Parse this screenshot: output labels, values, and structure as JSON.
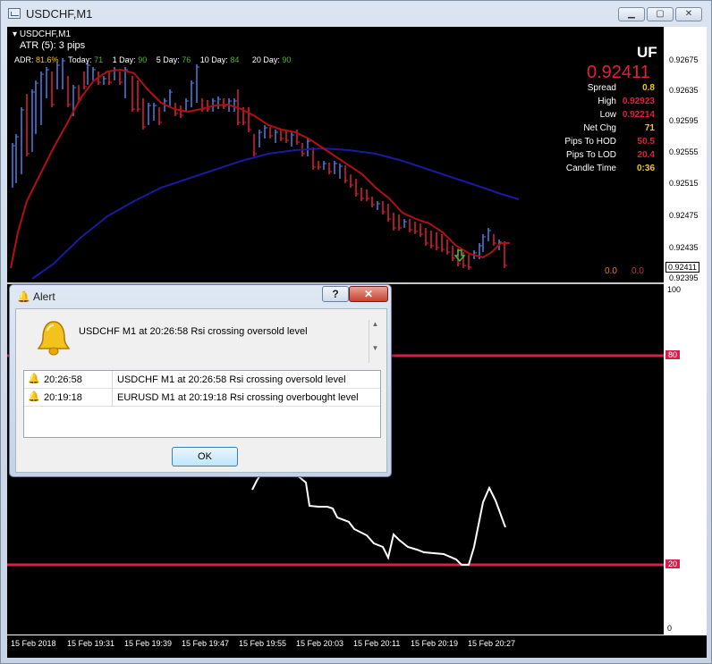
{
  "window": {
    "title": "USDCHF,M1",
    "min_glyph": "▁",
    "max_glyph": "▢",
    "close_glyph": "✕"
  },
  "chart": {
    "symbol_label": "USDCHF,M1",
    "atr_label": "ATR (5): 3 pips",
    "adr": {
      "label": "ADR:",
      "value": "81.6%"
    },
    "today": {
      "label": "Today:",
      "value": "71"
    },
    "day1": {
      "label": "1 Day:",
      "value": "90"
    },
    "day5": {
      "label": "5 Day:",
      "value": "76"
    },
    "day10": {
      "label": "10 Day:",
      "value": "84"
    },
    "day20": {
      "label": "20 Day:",
      "value": "90"
    },
    "symbol_short": "UF",
    "current_price": "0.92411",
    "info": [
      {
        "label": "Spread",
        "value": "0.8",
        "color": "#f5c518"
      },
      {
        "label": "High",
        "value": "0.92923",
        "color": "#e0203a"
      },
      {
        "label": "Low",
        "value": "0.92214",
        "color": "#e0203a"
      },
      {
        "label": "Net Chg",
        "value": "71",
        "color": "#f5c518"
      },
      {
        "label": "Pips To HOD",
        "value": "50.5",
        "color": "#e0203a"
      },
      {
        "label": "Pips To LOD",
        "value": "20.4",
        "color": "#e0203a"
      },
      {
        "label": "Candle Time",
        "value": "0:36",
        "color": "#f5c518"
      }
    ],
    "bottom_vals": [
      "0.0",
      "0.0"
    ],
    "price_ticks": [
      "0.92675",
      "0.92635",
      "0.92595",
      "0.92555",
      "0.92515",
      "0.92475",
      "0.92435",
      "0.92411",
      "0.92395"
    ],
    "rsi_ticks": [
      "100",
      "80",
      "20",
      "0"
    ],
    "time_ticks": [
      "15 Feb 2018",
      "15 Feb 19:31",
      "15 Feb 19:39",
      "15 Feb 19:47",
      "15 Feb 19:55",
      "15 Feb 20:03",
      "15 Feb 20:11",
      "15 Feb 20:19",
      "15 Feb 20:27"
    ],
    "rsi_levels": {
      "overbought": 80,
      "oversold": 20
    },
    "colors": {
      "bull": "#4a7fe0",
      "bear": "#e0203a",
      "ma_fast": "#b01010",
      "ma_slow": "#1a1aa0",
      "rsi": "#ffffff",
      "level": "#d6204a"
    }
  },
  "alert": {
    "title": "Alert",
    "help_label": "?",
    "close_label": "✕",
    "message": "USDCHF M1 at 20:26:58 Rsi crossing oversold level",
    "rows": [
      {
        "time": "20:26:58",
        "message": "USDCHF M1 at 20:26:58 Rsi crossing oversold level"
      },
      {
        "time": "20:19:18",
        "message": "EURUSD M1 at 20:19:18 Rsi crossing overbought level"
      }
    ],
    "ok_label": "OK"
  }
}
